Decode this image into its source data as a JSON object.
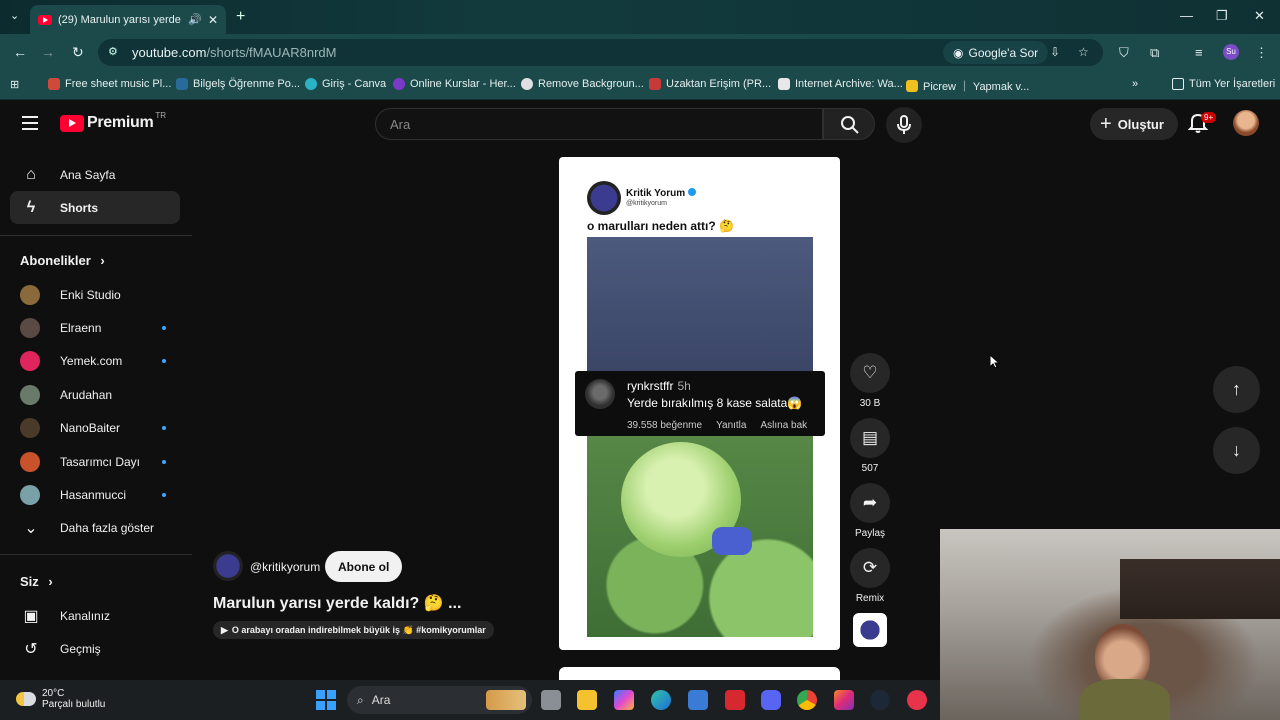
{
  "browser": {
    "tab_title": "(29) Marulun yarısı yerde k",
    "url_host": "youtube.com",
    "url_path": "/shorts/fMAUAR8nrdM",
    "google_sor": "Google'a Sor",
    "profile": "Su",
    "bookmarks": [
      "Free sheet music Pl...",
      "Bilgelş Öğrenme Po...",
      "Giriş - Canva",
      "Online Kurslar - Her...",
      "Remove Backgroun...",
      "Uzaktan Erişim (PR...",
      "Internet Archive: Wa...",
      "Picrew ｜ Yapmak v..."
    ],
    "all_bookmarks": "Tüm Yer İşaretleri"
  },
  "header": {
    "logo": "Premium",
    "region": "TR",
    "search_placeholder": "Ara",
    "create_label": "Oluştur",
    "notif_badge": "9+"
  },
  "sidebar": {
    "nav": [
      {
        "label": "Ana Sayfa",
        "icon": "home-icon"
      },
      {
        "label": "Shorts",
        "icon": "shorts-icon"
      }
    ],
    "subs_title": "Abonelikler",
    "subs": [
      {
        "label": "Enki Studio",
        "color": "#8a6a3a",
        "dot": false
      },
      {
        "label": "Elraenn",
        "color": "#5a4a44",
        "dot": true
      },
      {
        "label": "Yemek.com",
        "color": "#e0245e",
        "dot": true
      },
      {
        "label": "Arudahan",
        "color": "#6a7a6a",
        "dot": false
      },
      {
        "label": "NanoBaiter",
        "color": "#4a3a2a",
        "dot": true
      },
      {
        "label": "Tasarımcı Dayı",
        "color": "#c8532a",
        "dot": true
      },
      {
        "label": "Hasanmucci",
        "color": "#7aa0a8",
        "dot": true
      }
    ],
    "show_more": "Daha fazla göster",
    "you_title": "Siz",
    "you_items": [
      {
        "label": "Kanalınız",
        "icon": "channel-icon"
      },
      {
        "label": "Geçmiş",
        "icon": "history-icon"
      }
    ]
  },
  "short": {
    "card_channel": "Kritik Yorum",
    "card_handle": "@kritikyorum",
    "card_question": "o marulları neden attı? 🤔",
    "comment_user": "rynkrstffr",
    "comment_time": "5h",
    "comment_text": "Yerde bırakılmış 8 kase salata😱",
    "comment_likes": "39.558 beğenme",
    "comment_reply": "Yanıtla",
    "comment_see": "Aslına bak",
    "handle": "@kritikyorum",
    "subscribe": "Abone ol",
    "title": "Marulun yarısı yerde kaldı? 🤔 ...",
    "sound": "O arabayı oradan indirebilmek büyük iş 👏 #komikyorumlar",
    "actions": [
      {
        "name": "like",
        "icon": "♡",
        "label": "30 B"
      },
      {
        "name": "comment",
        "icon": "▤",
        "label": "507"
      },
      {
        "name": "share",
        "icon": "➦",
        "label": "Paylaş"
      },
      {
        "name": "remix",
        "icon": "⟳",
        "label": "Remix"
      }
    ]
  },
  "taskbar": {
    "temp": "20°C",
    "weather": "Parçalı bulutlu",
    "search": "Ara"
  }
}
